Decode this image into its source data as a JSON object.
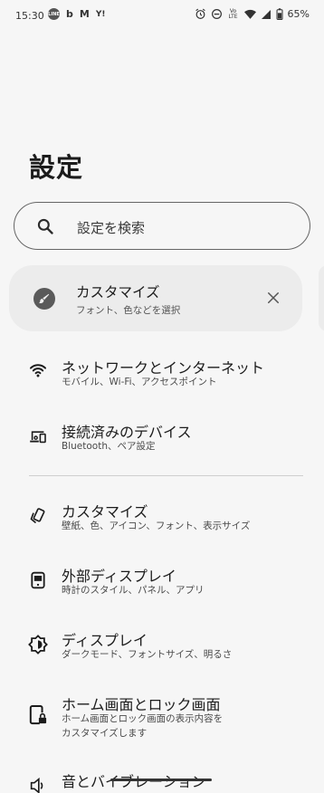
{
  "status_bar": {
    "time": "15:30",
    "notifications": [
      "LINE",
      "b",
      "M",
      "Y!"
    ],
    "volte": "Vo LTE",
    "battery": "65%"
  },
  "page": {
    "title": "設定"
  },
  "search": {
    "placeholder": "設定を検索"
  },
  "suggestion": {
    "title": "カスタマイズ",
    "subtitle": "フォント、色などを選択"
  },
  "settings": [
    {
      "title": "ネットワークとインターネット",
      "subtitle": "モバイル、Wi-Fi、アクセスポイント",
      "icon": "wifi-icon"
    },
    {
      "title": "接続済みのデバイス",
      "subtitle": "Bluetooth、ペア設定",
      "icon": "devices-icon"
    },
    {
      "title": "カスタマイズ",
      "subtitle": "壁紙、色、アイコン、フォント、表示サイズ",
      "icon": "customize-icon"
    },
    {
      "title": "外部ディスプレイ",
      "subtitle": "時計のスタイル、パネル、アプリ",
      "icon": "external-display-icon"
    },
    {
      "title": "ディスプレイ",
      "subtitle": "ダークモード、フォントサイズ、明るさ",
      "icon": "display-brightness-icon"
    },
    {
      "title": "ホーム画面とロック画面",
      "subtitle_line1": "ホーム画面とロック画面の表示内容を",
      "subtitle_line2": "カスタマイズします",
      "icon": "lock-screen-icon"
    },
    {
      "title": "音とバイブレーション",
      "icon": "sound-icon"
    }
  ]
}
